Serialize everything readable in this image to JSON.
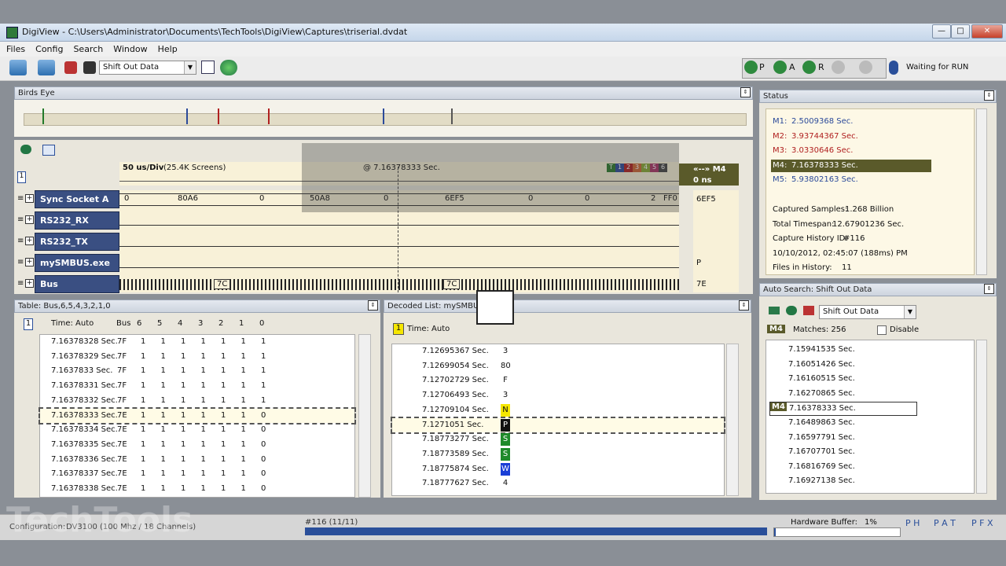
{
  "window": {
    "title": "DigiView - C:\\Users\\Administrator\\Documents\\TechTools\\DigiView\\Captures\\triserial.dvdat"
  },
  "menu": [
    "Files",
    "Config",
    "Search",
    "Window",
    "Help"
  ],
  "toolbar": {
    "search_combo": "Shift Out Data",
    "run_buttons": [
      "P",
      "A",
      "R"
    ],
    "status_text": "Waiting for RUN"
  },
  "birds_eye": {
    "title": "Birds Eye"
  },
  "waveform": {
    "scale": "50 us/Div",
    "screens": "(25.4K Screens)",
    "cursor_time": "@ 7.16378333 Sec.",
    "marker_label": "«--» M4",
    "delta": "0 ns",
    "pane_index": "1",
    "color_tags": [
      "T",
      "1",
      "2",
      "3",
      "4",
      "5",
      "6"
    ],
    "channels": [
      {
        "name": "Sync Socket A",
        "value": "6EF5",
        "segments": [
          "0",
          "80A6",
          "0",
          "50A8",
          "0",
          "6EF5",
          "0",
          "0",
          "2",
          "FF0"
        ]
      },
      {
        "name": "RS232_RX",
        "value": "",
        "segments": []
      },
      {
        "name": "RS232_TX",
        "value": "",
        "segments": []
      },
      {
        "name": "mySMBUS.exe",
        "value": "P",
        "segments": []
      },
      {
        "name": "Bus",
        "value": "7E",
        "segments": [
          "7C",
          "7C"
        ]
      }
    ]
  },
  "table": {
    "title": "Table: Bus,6,5,4,3,2,1,0",
    "pane_index": "1",
    "time_header": "Time: Auto",
    "columns": [
      "Bus",
      "6",
      "5",
      "4",
      "3",
      "2",
      "1",
      "0"
    ],
    "rows": [
      {
        "time": "7.16378328 Sec.",
        "bus": "7F",
        "bits": [
          "1",
          "1",
          "1",
          "1",
          "1",
          "1",
          "1"
        ]
      },
      {
        "time": "7.16378329 Sec.",
        "bus": "7F",
        "bits": [
          "1",
          "1",
          "1",
          "1",
          "1",
          "1",
          "1"
        ]
      },
      {
        "time": "7.1637833 Sec.",
        "bus": "7F",
        "bits": [
          "1",
          "1",
          "1",
          "1",
          "1",
          "1",
          "1"
        ]
      },
      {
        "time": "7.16378331 Sec.",
        "bus": "7F",
        "bits": [
          "1",
          "1",
          "1",
          "1",
          "1",
          "1",
          "1"
        ]
      },
      {
        "time": "7.16378332 Sec.",
        "bus": "7F",
        "bits": [
          "1",
          "1",
          "1",
          "1",
          "1",
          "1",
          "1"
        ]
      },
      {
        "time": "7.16378333 Sec.",
        "bus": "7E",
        "bits": [
          "1",
          "1",
          "1",
          "1",
          "1",
          "1",
          "0"
        ]
      },
      {
        "time": "7.16378334 Sec.",
        "bus": "7E",
        "bits": [
          "1",
          "1",
          "1",
          "1",
          "1",
          "1",
          "0"
        ]
      },
      {
        "time": "7.16378335 Sec.",
        "bus": "7E",
        "bits": [
          "1",
          "1",
          "1",
          "1",
          "1",
          "1",
          "0"
        ]
      },
      {
        "time": "7.16378336 Sec.",
        "bus": "7E",
        "bits": [
          "1",
          "1",
          "1",
          "1",
          "1",
          "1",
          "0"
        ]
      },
      {
        "time": "7.16378337 Sec.",
        "bus": "7E",
        "bits": [
          "1",
          "1",
          "1",
          "1",
          "1",
          "1",
          "0"
        ]
      },
      {
        "time": "7.16378338 Sec.",
        "bus": "7E",
        "bits": [
          "1",
          "1",
          "1",
          "1",
          "1",
          "1",
          "0"
        ]
      }
    ]
  },
  "decoded": {
    "title": "Decoded List: mySMBUS",
    "pane_index": "1",
    "time_header": "Time:  Auto",
    "rows": [
      {
        "time": "7.12695367 Sec.",
        "val": "3",
        "color": ""
      },
      {
        "time": "7.12699054 Sec.",
        "val": "80",
        "color": ""
      },
      {
        "time": "7.12702729 Sec.",
        "val": "F",
        "color": ""
      },
      {
        "time": "7.12706493 Sec.",
        "val": "3",
        "color": ""
      },
      {
        "time": "7.12709104 Sec.",
        "val": "N",
        "color": "#f5e600"
      },
      {
        "time": "7.1271051 Sec.",
        "val": "P",
        "color": "#111111"
      },
      {
        "time": "7.18773277 Sec.",
        "val": "S",
        "color": "#1f8a2a"
      },
      {
        "time": "7.18773589 Sec.",
        "val": "S",
        "color": "#1f8a2a"
      },
      {
        "time": "7.18775874 Sec.",
        "val": "W",
        "color": "#1a3fd6"
      },
      {
        "time": "7.18777627 Sec.",
        "val": "4",
        "color": ""
      }
    ]
  },
  "status_panel": {
    "title": "Status",
    "markers": [
      {
        "label": "M1:",
        "value": "2.5009368 Sec.",
        "color": "#2b4a9a"
      },
      {
        "label": "M2:",
        "value": "3.93744367 Sec.",
        "color": "#b02020"
      },
      {
        "label": "M3:",
        "value": "3.0330646 Sec.",
        "color": "#b02020"
      },
      {
        "label": "M4:",
        "value": "7.16378333 Sec.",
        "color": "#ffffff"
      },
      {
        "label": "M5:",
        "value": "5.93802163 Sec.",
        "color": "#2b4a9a"
      }
    ],
    "info": [
      {
        "label": "Captured Samples:",
        "value": "1.268 Billion"
      },
      {
        "label": "Total Timespan:",
        "value": "12.67901236 Sec."
      },
      {
        "label": "Capture History ID:",
        "value": "#116"
      },
      {
        "label": "10/10/2012, 02:45:07 (188ms) PM",
        "value": ""
      },
      {
        "label": "Files in History:",
        "value": "11"
      }
    ]
  },
  "auto_search": {
    "title": "Auto Search: Shift Out Data",
    "combo": "Shift Out Data",
    "marker_tag": "M4",
    "matches": "Matches: 256",
    "disable_label": "Disable",
    "rows": [
      "7.15941535 Sec.",
      "7.16051426 Sec.",
      "7.16160515 Sec.",
      "7.16270865 Sec.",
      "7.16378333 Sec.",
      "7.16489863 Sec.",
      "7.16597791 Sec.",
      "7.16707701 Sec.",
      "7.16816769 Sec.",
      "7.16927138 Sec."
    ],
    "selected_index": 4
  },
  "statusbar": {
    "config_label": "Configuration:",
    "config_value": "DV3100 (100 Mhz / 18 Channels)",
    "history": "#116 (11/11)",
    "hw_label": "Hardware Buffer:",
    "hw_value": "1%",
    "flags1": "P H",
    "flags2": "P A T",
    "flags3": "P F X"
  },
  "watermark": "TechTools"
}
